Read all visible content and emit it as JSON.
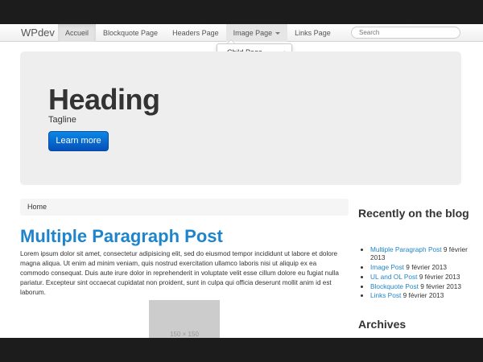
{
  "navbar": {
    "brand": "WPdev",
    "items": [
      {
        "label": "Accueil"
      },
      {
        "label": "Blockquote Page"
      },
      {
        "label": "Headers Page"
      },
      {
        "label": "Image Page"
      },
      {
        "label": "Links Page"
      }
    ],
    "search_placeholder": "Search"
  },
  "dropdown": {
    "item": "Child Page"
  },
  "hero": {
    "heading": "Heading",
    "tagline": "Tagline",
    "button": "Learn more"
  },
  "breadcrumb": {
    "home": "Home"
  },
  "post": {
    "title": "Multiple Paragraph Post",
    "body": "Lorem ipsum dolor sit amet, consectetur adipisicing elit, sed do eiusmod tempor incididunt ut labore et dolore magna aliqua. Ut enim ad minim veniam, quis nostrud exercitation ullamco laboris nisi ut aliquip ex ea commodo consequat. Duis aute irure dolor in reprehenderit in voluptate velit esse cillum dolore eu fugiat nulla pariatur. Excepteur sint occaecat cupidatat non proident, sunt in culpa qui officia deserunt mollit anim id est laborum.",
    "image_label": "150 × 150"
  },
  "sidebar": {
    "recent_title": "Recently on the blog",
    "recent": [
      {
        "title": "Multiple Paragraph Post",
        "date": "9 février 2013"
      },
      {
        "title": "Image Post",
        "date": "9 février 2013"
      },
      {
        "title": "UL and OL Post",
        "date": "9 février 2013"
      },
      {
        "title": "Blockquote Post",
        "date": "9 février 2013"
      },
      {
        "title": "Links Post",
        "date": "9 février 2013"
      }
    ],
    "archives_title": "Archives"
  }
}
